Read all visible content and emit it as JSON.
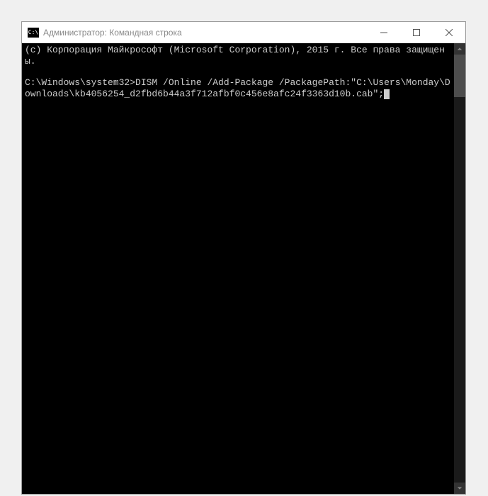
{
  "window": {
    "title": "Администратор: Командная строка",
    "icon_label": "C:\\"
  },
  "console": {
    "copyright_line": "(c) Корпорация Майкрософт (Microsoft Corporation), 2015 г. Все права защищены.",
    "prompt": "C:\\Windows\\system32>",
    "command": "DISM /Online /Add-Package /PackagePath:\"C:\\Users\\Monday\\Downloads\\kb4056254_d2fbd6b44a3f712afbf0c456e8afc24f3363d10b.cab\";"
  }
}
